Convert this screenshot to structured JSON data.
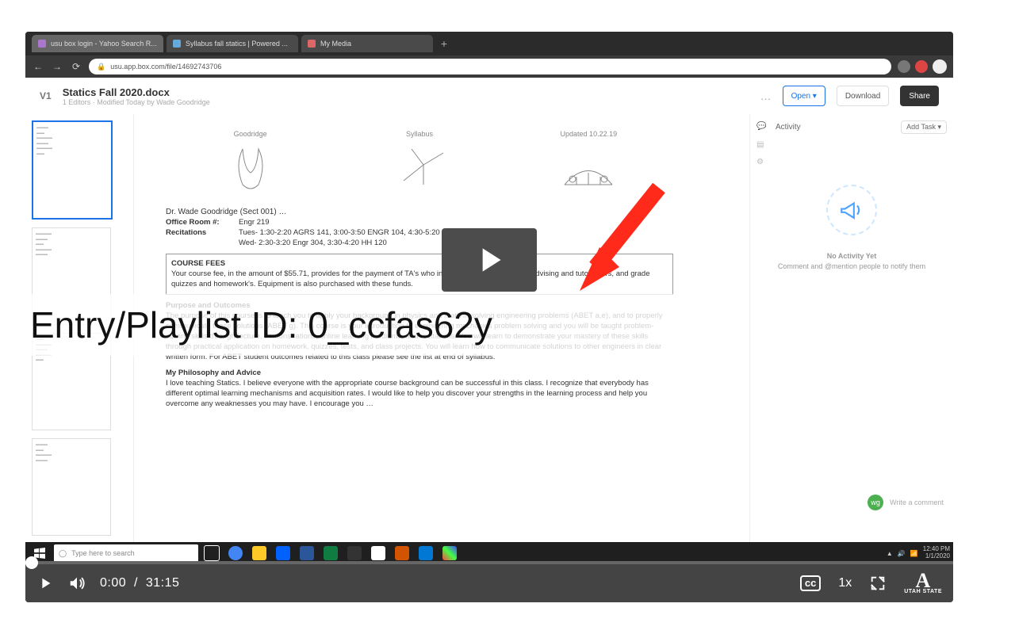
{
  "overlay": {
    "id_label": "Entry/Playlist ID: 0_ccfas62y"
  },
  "player": {
    "current_time": "0:00",
    "duration": "31:15",
    "time_sep": "/",
    "speed": "1x",
    "cc": "cc",
    "brand_letter": "A",
    "brand_label": "UTAH STATE"
  },
  "browser": {
    "tabs": [
      {
        "label": "usu box login - Yahoo Search R..."
      },
      {
        "label": "Syllabus fall statics | Powered ..."
      },
      {
        "label": "My Media"
      }
    ],
    "url": "usu.app.box.com/file/14692743706",
    "nav": {
      "back": "←",
      "fwd": "→",
      "reload": "⟳"
    }
  },
  "box": {
    "version": "V1",
    "title": "Statics Fall 2020.docx",
    "subtitle": "1 Editors · Modified Today by Wade Goodridge",
    "open_btn": "Open ▾",
    "download_btn": "Download",
    "share_btn": "Share",
    "more": "…",
    "sidebar": {
      "activity_label": "Activity",
      "addtask": "Add Task ▾",
      "noactivity_title": "No Activity Yet",
      "noactivity_sub": "Comment and @mention people to notify them",
      "comment_placeholder": "Write a comment"
    }
  },
  "doc": {
    "col_labels": [
      "Goodridge",
      "Syllabus",
      "Updated 10.22.19"
    ],
    "instructor": "Dr. Wade Goodridge (Sect 001) …",
    "office_label": "Office Room #:",
    "office_value": "Engr 219",
    "recitations_label": "Recitations",
    "rec_lines": [
      "Tues- 1:30-2:20 AGRS 141,   3:00-3:50 ENGR 104,   4:30-5:20 Engr 104",
      "Wed- 2:30-3:20 Engr 304,   3:30-4:20 HH 120"
    ],
    "fees_title": "COURSE FEES",
    "fees_body": "Your course fee, in the amount of $55.71, provides for the payment of TA's who instruct the recitations, offer advising and tutor hours, and grade quizzes and homework's. Equipment is also purchased with these funds.",
    "purpose_title": "Purpose and Outcomes",
    "purpose_body": "The purpose of this course is to teach you to apply your background in physics and math in solving engineering problems (ABET a,e), and to properly communicate those solutions (ABET g). This course is your introduction to engineering mechanics problem solving and you will be taught problem-solving skills through lecture, demonstrations, online learning mediums, and recitations. You will learn to demonstrate your mastery of these skills through practical application on homework, quizzes, tests, and class projects. You will learn how to communicate solutions to other engineers in clear written form. For ABET student outcomes related to this class please see the list at end of syllabus.",
    "phil_title": "My Philosophy and Advice",
    "phil_body": "I love teaching Statics. I believe everyone with the appropriate course background can be successful in this class. I recognize that everybody has different optimal learning mechanisms and acquisition rates. I would like to help you discover your strengths in the learning process and help you overcome any weaknesses you may have. I encourage you …"
  },
  "taskbar": {
    "search_placeholder": "Type here to search",
    "time": "12:40 PM",
    "date": "1/1/2020"
  }
}
